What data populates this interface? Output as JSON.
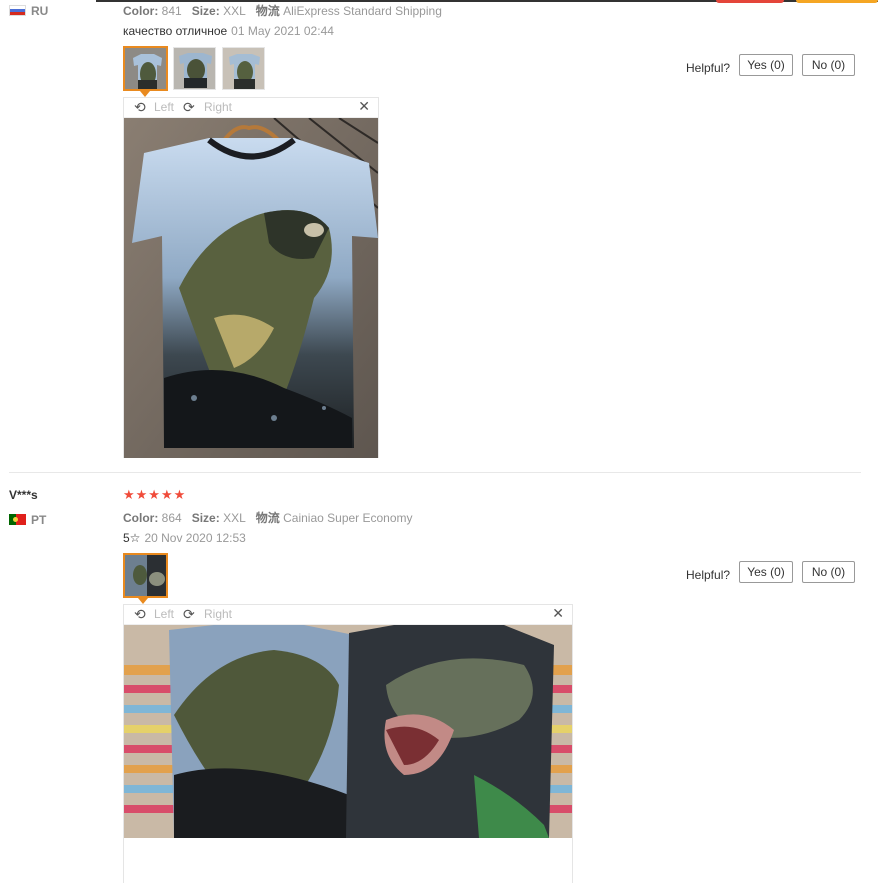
{
  "review1": {
    "country": "RU",
    "meta": {
      "color_label": "Color:",
      "color_value": "841",
      "size_label": "Size:",
      "size_value": "XXL",
      "shipping_label": "物流",
      "shipping_value": "AliExpress Standard Shipping"
    },
    "feedback": "качество отличное",
    "date": "01 May 2021 02:44",
    "helpful_label": "Helpful?",
    "yes_label": "Yes (0)",
    "no_label": "No (0)",
    "viewer": {
      "left_label": "Left",
      "right_label": "Right"
    }
  },
  "review2": {
    "username": "V***s",
    "country": "PT",
    "stars": "★★★★★",
    "rating": 5,
    "meta": {
      "color_label": "Color:",
      "color_value": "864",
      "size_label": "Size:",
      "size_value": "XXL",
      "shipping_label": "物流",
      "shipping_value": "Cainiao Super Economy"
    },
    "feedback": "5☆",
    "date": "20 Nov 2020 12:53",
    "helpful_label": "Helpful?",
    "yes_label": "Yes (0)",
    "no_label": "No (0)",
    "viewer": {
      "left_label": "Left",
      "right_label": "Right"
    }
  },
  "colors": {
    "accent": "#e98a1f",
    "star": "#f04b3a",
    "top_red": "#e4453a",
    "top_yellow": "#f5a623"
  }
}
